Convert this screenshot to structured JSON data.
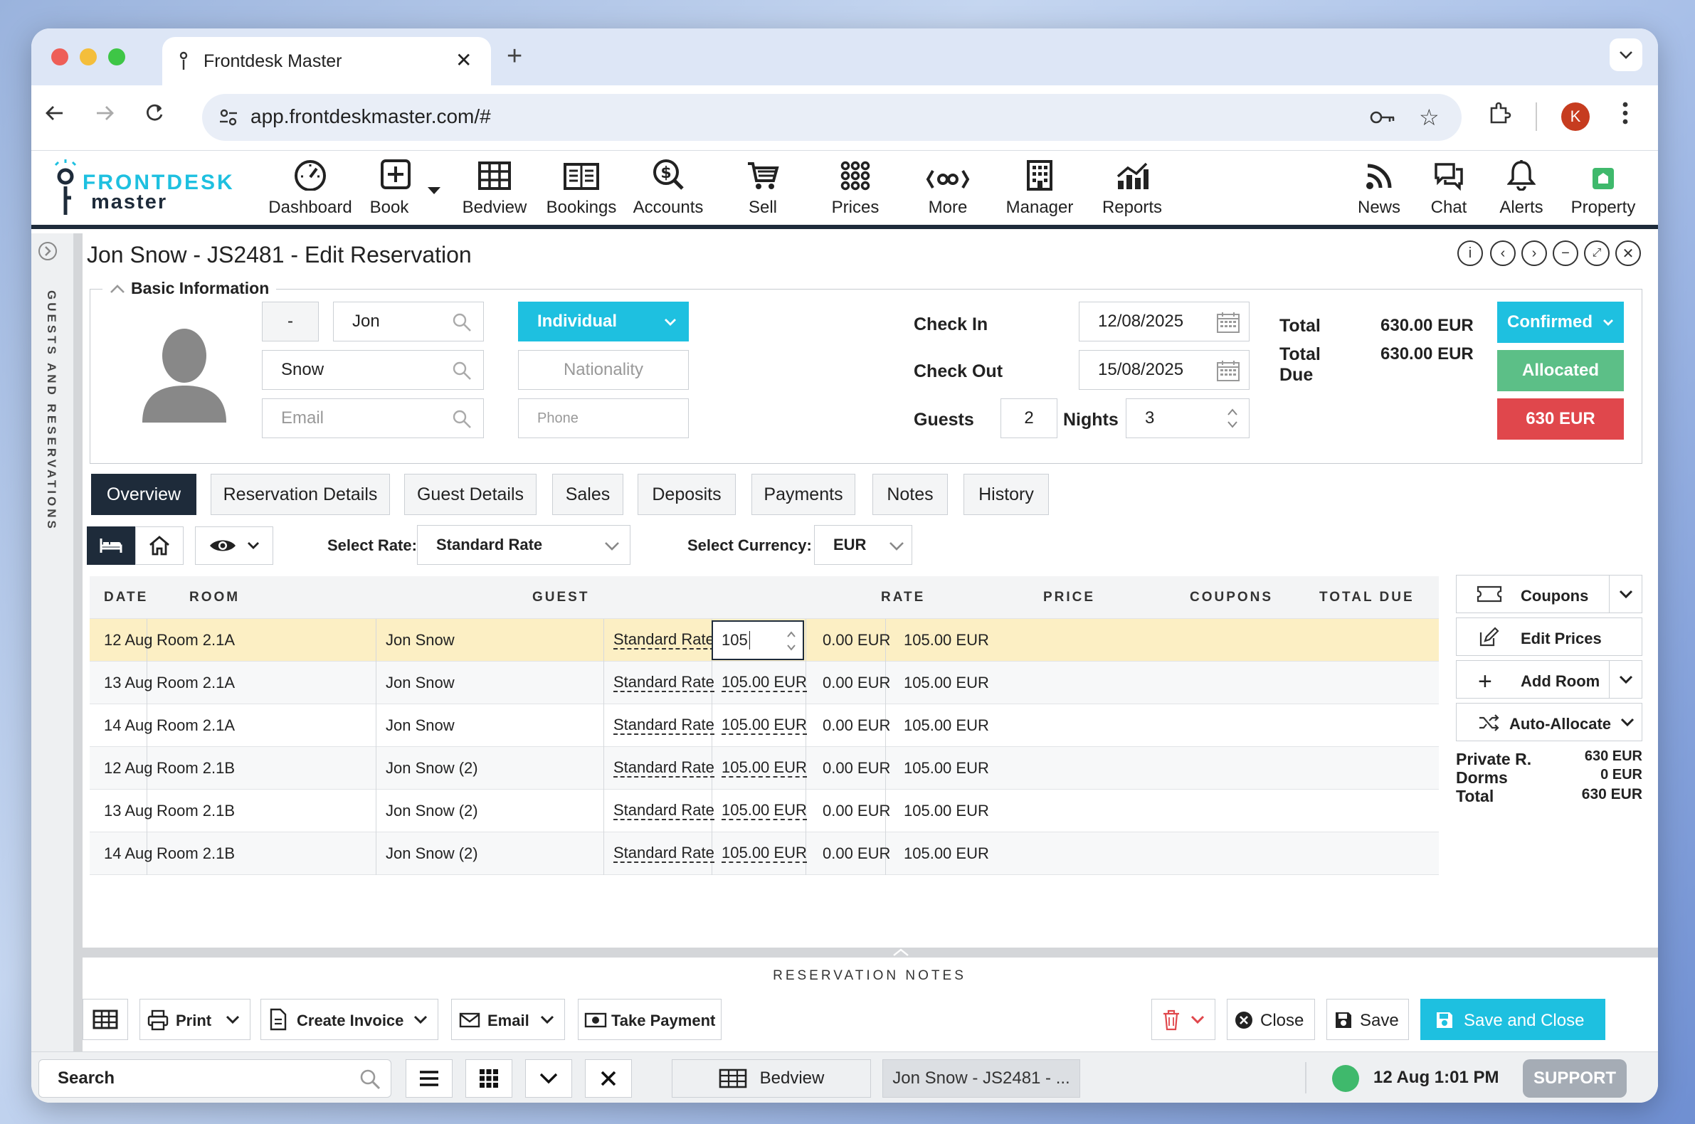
{
  "browser": {
    "tab_title": "Frontdesk Master",
    "url": "app.frontdeskmaster.com/#",
    "profile_initial": "K"
  },
  "logo": {
    "line1": "FRONTDESK",
    "line2": "master"
  },
  "nav": {
    "dashboard": "Dashboard",
    "book": "Book",
    "bedview": "Bedview",
    "bookings": "Bookings",
    "accounts": "Accounts",
    "sell": "Sell",
    "prices": "Prices",
    "more": "More",
    "manager": "Manager",
    "reports": "Reports",
    "news": "News",
    "chat": "Chat",
    "alerts": "Alerts",
    "property": "Property"
  },
  "sidebar": {
    "label": "GUESTS AND RESERVATIONS"
  },
  "page": {
    "title": "Jon Snow - JS2481 - Edit Reservation"
  },
  "basic": {
    "legend": "Basic Information",
    "title_select": "-",
    "first_name": "Jon",
    "last_name": "Snow",
    "email_placeholder": "Email",
    "guest_type": "Individual",
    "nationality_placeholder": "Nationality",
    "phone_placeholder": "Phone",
    "check_in_label": "Check In",
    "check_in": "12/08/2025",
    "check_out_label": "Check Out",
    "check_out": "15/08/2025",
    "guests_label": "Guests",
    "guests": "2",
    "nights_label": "Nights",
    "nights": "3",
    "total_label": "Total",
    "total": "630.00 EUR",
    "total_due_label": "Total Due",
    "total_due": "630.00 EUR",
    "status": "Confirmed",
    "allocation": "Allocated",
    "balance": "630 EUR"
  },
  "tabs": [
    "Overview",
    "Reservation Details",
    "Guest Details",
    "Sales",
    "Deposits",
    "Payments",
    "Notes",
    "History"
  ],
  "rate_bar": {
    "select_rate_label": "Select Rate:",
    "rate": "Standard Rate",
    "select_currency_label": "Select Currency:",
    "currency": "EUR"
  },
  "table": {
    "headers": [
      "DATE",
      "ROOM",
      "GUEST",
      "RATE",
      "PRICE",
      "COUPONS",
      "TOTAL DUE"
    ],
    "rows": [
      {
        "date": "12 Aug",
        "room": "Room 2.1A",
        "guest": "Jon Snow",
        "rate": "Standard Rate",
        "price": "105",
        "coupons": "0.00 EUR",
        "total": "105.00 EUR"
      },
      {
        "date": "13 Aug",
        "room": "Room 2.1A",
        "guest": "Jon Snow",
        "rate": "Standard Rate",
        "price": "105.00 EUR",
        "coupons": "0.00 EUR",
        "total": "105.00 EUR"
      },
      {
        "date": "14 Aug",
        "room": "Room 2.1A",
        "guest": "Jon Snow",
        "rate": "Standard Rate",
        "price": "105.00 EUR",
        "coupons": "0.00 EUR",
        "total": "105.00 EUR"
      },
      {
        "date": "12 Aug",
        "room": "Room 2.1B",
        "guest": "Jon Snow (2)",
        "rate": "Standard Rate",
        "price": "105.00 EUR",
        "coupons": "0.00 EUR",
        "total": "105.00 EUR"
      },
      {
        "date": "13 Aug",
        "room": "Room 2.1B",
        "guest": "Jon Snow (2)",
        "rate": "Standard Rate",
        "price": "105.00 EUR",
        "coupons": "0.00 EUR",
        "total": "105.00 EUR"
      },
      {
        "date": "14 Aug",
        "room": "Room 2.1B",
        "guest": "Jon Snow (2)",
        "rate": "Standard Rate",
        "price": "105.00 EUR",
        "coupons": "0.00 EUR",
        "total": "105.00 EUR"
      }
    ]
  },
  "actions": {
    "coupons": "Coupons",
    "edit_prices": "Edit Prices",
    "add_room": "Add Room",
    "auto_allocate": "Auto-Allocate"
  },
  "summary": {
    "private_label": "Private R.",
    "private_value": "630 EUR",
    "dorms_label": "Dorms",
    "dorms_value": "0 EUR",
    "total_label": "Total",
    "total_value": "630 EUR"
  },
  "notes": {
    "label": "RESERVATION NOTES"
  },
  "footer": {
    "print": "Print",
    "create_invoice": "Create Invoice",
    "email": "Email",
    "take_payment": "Take Payment",
    "close": "Close",
    "save": "Save",
    "save_close": "Save and Close"
  },
  "taskbar": {
    "search_label": "Search",
    "bedview": "Bedview",
    "current": "Jon Snow - JS2481 - ...",
    "datetime": "12 Aug 1:01 PM",
    "support": "SUPPORT"
  },
  "colors": {
    "accent": "#1ec0e0",
    "dark": "#1e2b3a",
    "allocated": "#5cbf87",
    "balance": "#e0474c",
    "selected_row": "#fcefc4"
  }
}
